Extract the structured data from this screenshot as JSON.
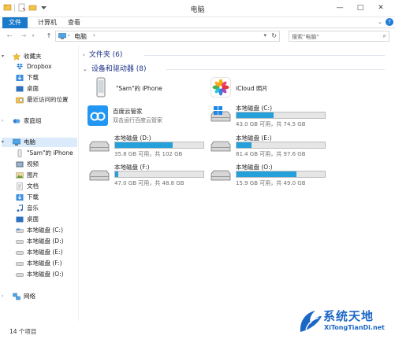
{
  "window": {
    "title": "电脑",
    "minimize": "—",
    "maximize": "□",
    "close": "✕"
  },
  "ribbon": {
    "tabs": [
      "文件",
      "计算机",
      "查看"
    ],
    "help": "?"
  },
  "address": {
    "crumb": "电脑",
    "search_placeholder": "搜索\"电脑\""
  },
  "sidebar": {
    "favorites_label": "收藏夹",
    "favorites": [
      "Dropbox",
      "下载",
      "桌面",
      "最近访问的位置"
    ],
    "homegroup_label": "家庭组",
    "pc_label": "电脑",
    "pc_items": [
      "\"Sam\"的 iPhone",
      "视频",
      "图片",
      "文档",
      "下载",
      "音乐",
      "桌面",
      "本地磁盘 (C:)",
      "本地磁盘 (D:)",
      "本地磁盘 (E:)",
      "本地磁盘 (F:)",
      "本地磁盘 (O:)"
    ],
    "network_label": "网络"
  },
  "content": {
    "folders_group": "文件夹 (6)",
    "devices_group": "设备和驱动器 (8)",
    "devices": [
      {
        "name": "\"Sam\"的 iPhone",
        "desc": "",
        "icon": "iphone-icon"
      },
      {
        "name": "iCloud 照片",
        "desc": "",
        "icon": "icloud-photos-icon"
      },
      {
        "name": "百度云管家",
        "desc": "双击运行百度云管家",
        "icon": "baidu-cloud-icon"
      }
    ],
    "drives": [
      {
        "name": "本地磁盘 (C:)",
        "desc": "43.0 GB 可用，共 74.5 GB",
        "used_fraction": 0.423,
        "icon": "windows-drive-icon"
      },
      {
        "name": "本地磁盘 (D:)",
        "desc": "35.8 GB 可用，共 102 GB",
        "used_fraction": 0.649,
        "icon": "drive-icon"
      },
      {
        "name": "本地磁盘 (E:)",
        "desc": "81.4 GB 可用，共 97.6 GB",
        "used_fraction": 0.166,
        "icon": "drive-icon"
      },
      {
        "name": "本地磁盘 (F:)",
        "desc": "47.0 GB 可用，共 48.8 GB",
        "used_fraction": 0.037,
        "icon": "drive-icon"
      },
      {
        "name": "本地磁盘 (O:)",
        "desc": "15.9 GB 可用，共 49.0 GB",
        "used_fraction": 0.676,
        "icon": "drive-icon"
      }
    ]
  },
  "status": {
    "item_count": "14 个项目"
  },
  "watermark": {
    "text": "系统天地",
    "url": "XiTongTianDi.net"
  },
  "colors": {
    "accent": "#1979ca",
    "bar_fill": "#26a0da",
    "group_header": "#1e3287"
  }
}
